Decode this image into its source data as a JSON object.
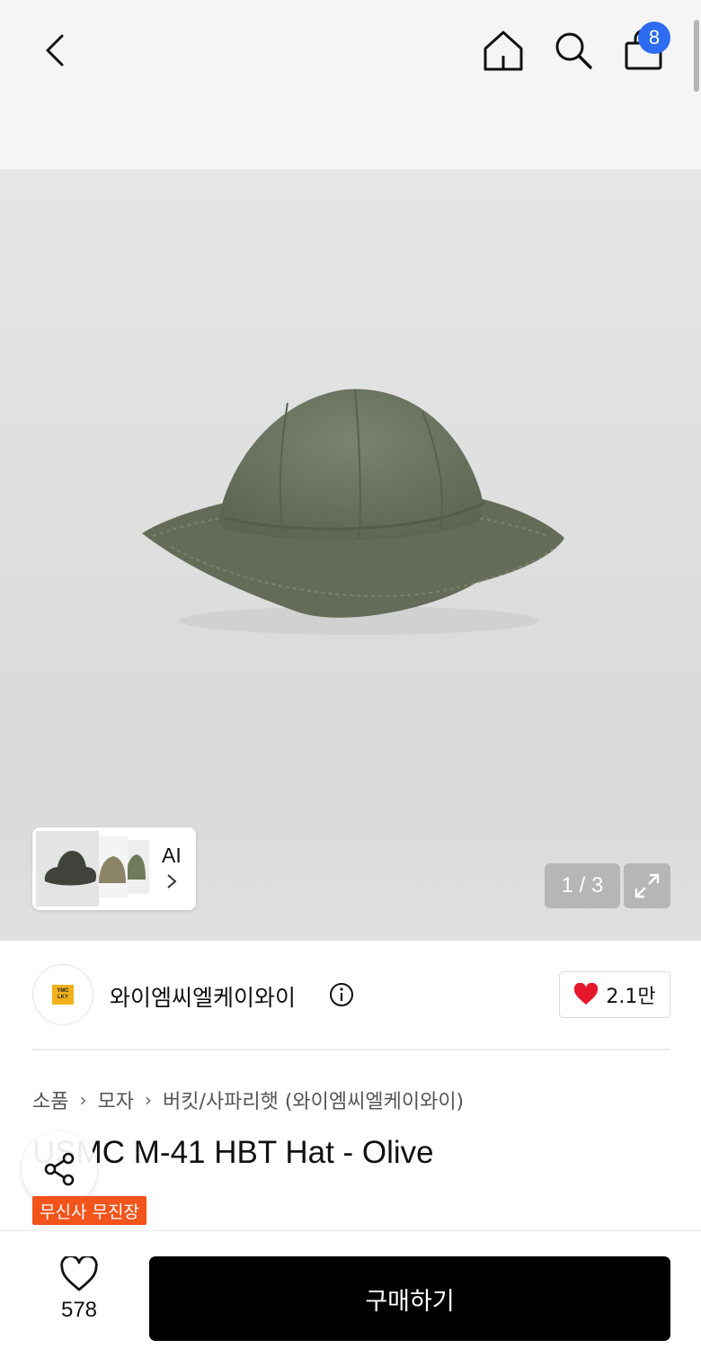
{
  "header": {
    "cart_badge": "8"
  },
  "hero": {
    "ai_label": "AI",
    "page_counter": "1 / 3"
  },
  "brand": {
    "logo_text_top": "YMC",
    "logo_text_bottom": "LKY",
    "name": "와이엠씨엘케이와이",
    "like_count": "2.1만"
  },
  "breadcrumb": [
    "소품",
    "모자",
    "버킷/사파리햇 (와이엠씨엘케이와이)"
  ],
  "product": {
    "title": "USMC M-41 HBT Hat - Olive",
    "tag": "무신사 무진장"
  },
  "bottom_bar": {
    "wish_count": "578",
    "buy_label": "구매하기"
  },
  "colors": {
    "accent_blue": "#2c6cf0",
    "tag_orange": "#f2541b",
    "heart_red": "#e5192b",
    "hat_olive": "#68705d"
  },
  "icons": [
    "back-arrow-icon",
    "home-icon",
    "search-icon",
    "shopping-bag-icon",
    "expand-icon",
    "info-icon",
    "heart-icon",
    "share-icon",
    "heart-outline-icon",
    "chevron-right-icon"
  ]
}
